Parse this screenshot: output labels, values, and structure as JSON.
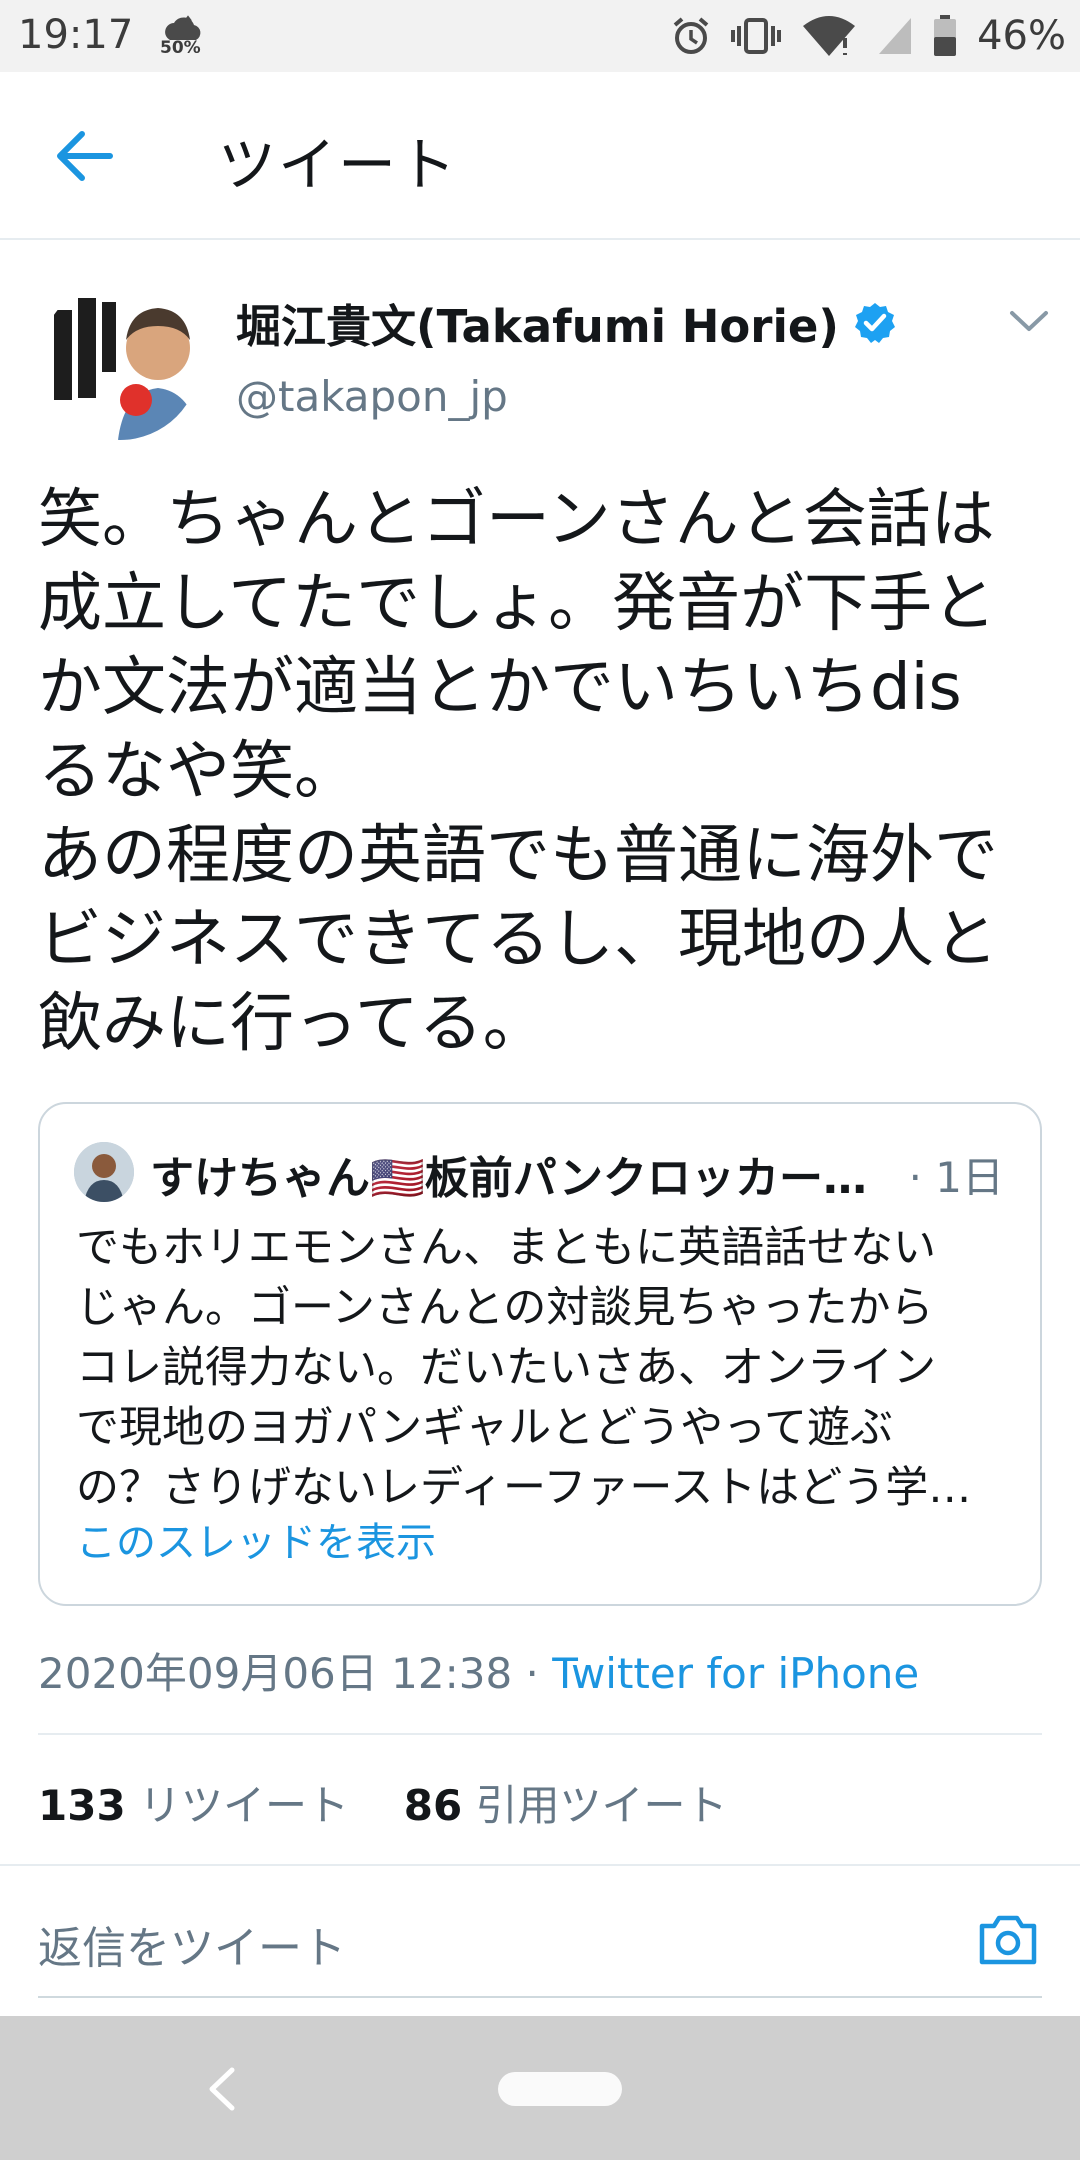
{
  "status_bar": {
    "time": "19:17",
    "weather_percent": "50%",
    "battery": "46%",
    "icons": [
      "cloud-icon",
      "alarm-icon",
      "vibrate-icon",
      "wifi-icon",
      "signal-icon",
      "battery-icon"
    ]
  },
  "header": {
    "title": "ツイート",
    "back_icon": "back-arrow-icon"
  },
  "author": {
    "name": "堀江貴文(Takafumi Horie)",
    "handle": "@takapon_jp",
    "verified": true
  },
  "tweet": {
    "text": "笑。ちゃんとゴーンさんと会話は\n成立してたでしょ。発音が下手と\nか文法が適当とかでいちいちdis\nるなや笑。\nあの程度の英語でも普通に海外で\nビジネスできてるし、現地の人と\n飲みに行ってる。"
  },
  "quoted_tweet": {
    "name": "すけちゃん🇺🇸板前パンクロッカー …",
    "time": "· 1日",
    "text": "でもホリエモンさん、まともに英語話せない\nじゃん。ゴーンさんとの対談見ちゃったから\nコレ説得力ない。だいたいさあ、オンライン\nで現地のヨガパンギャルとどうやって遊ぶ\nの？さりげないレディーファーストはどう学…",
    "show_thread": "このスレッドを表示"
  },
  "meta": {
    "datetime": "2020年09月06日 12:38",
    "separator": " · ",
    "source": "Twitter for iPhone"
  },
  "stats": {
    "retweets": "133",
    "retweets_label": " リツイート",
    "quotes": "86",
    "quotes_label": " 引用ツイート"
  },
  "reply": {
    "placeholder": "返信をツイート"
  },
  "colors": {
    "accent": "#1b95e0",
    "text": "#14171a",
    "secondary": "#657786",
    "border": "#e6ecf0"
  }
}
